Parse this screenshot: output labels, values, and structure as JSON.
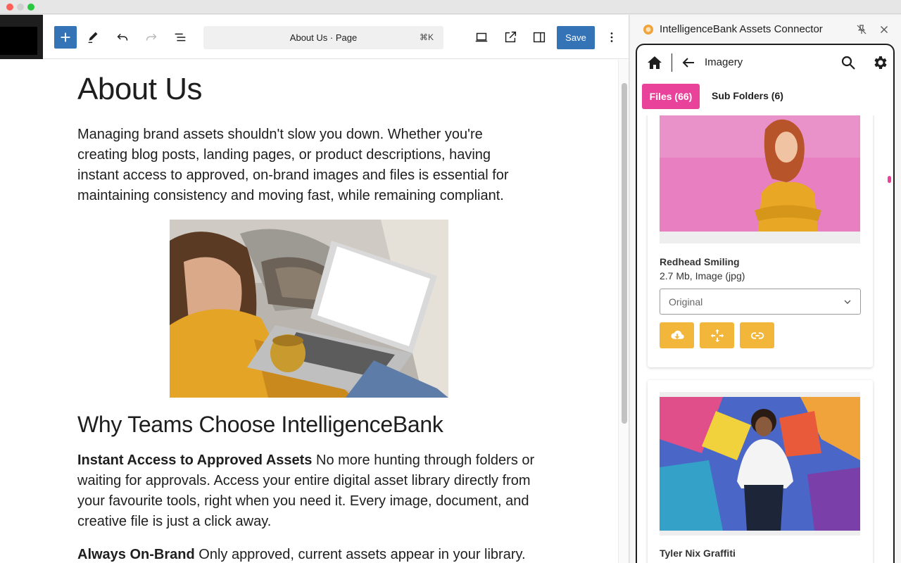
{
  "editor": {
    "document_title": "About Us · Page",
    "shortcut": "⌘K",
    "save_label": "Save",
    "heading": "About Us",
    "lead": "Managing brand assets shouldn't slow you down. Whether you're creating blog posts, landing pages, or product descriptions, having instant access to approved, on-brand images and files is essential for maintaining consistency and moving fast, while remaining compliant.",
    "subheading": "Why Teams Choose IntelligenceBank",
    "p2_strong": "Instant Access to Approved Assets",
    "p2_body": " No more hunting through folders or waiting for approvals. Access your entire digital asset library directly from your favourite tools, right when you need it. Every image, document, and creative file is just a click away.",
    "p3_strong": "Always On-Brand",
    "p3_body": " Only approved, current assets appear in your library."
  },
  "panel": {
    "title": "IntelligenceBank Assets Connector",
    "folder": "Imagery",
    "tab_files": "Files (66)",
    "tab_subfolders": "Sub Folders (6)",
    "accent": "#e8429b",
    "action_color": "#f2b63a",
    "assets": [
      {
        "name": "Redhead Smiling",
        "meta": "2.7 Mb, Image (jpg)",
        "size_option": "Original"
      },
      {
        "name": "Tyler Nix Graffiti",
        "meta": ""
      }
    ]
  },
  "icons": [
    "plus-icon",
    "pencil-icon",
    "undo-icon",
    "redo-icon",
    "list-view-icon",
    "laptop-icon",
    "external-link-icon",
    "sidebar-icon",
    "more-vertical-icon",
    "home-icon",
    "arrow-left-icon",
    "search-icon",
    "gear-icon",
    "pin-off-icon",
    "close-icon",
    "chevron-down-icon",
    "cloud-download-icon",
    "move-icon",
    "link-icon"
  ]
}
